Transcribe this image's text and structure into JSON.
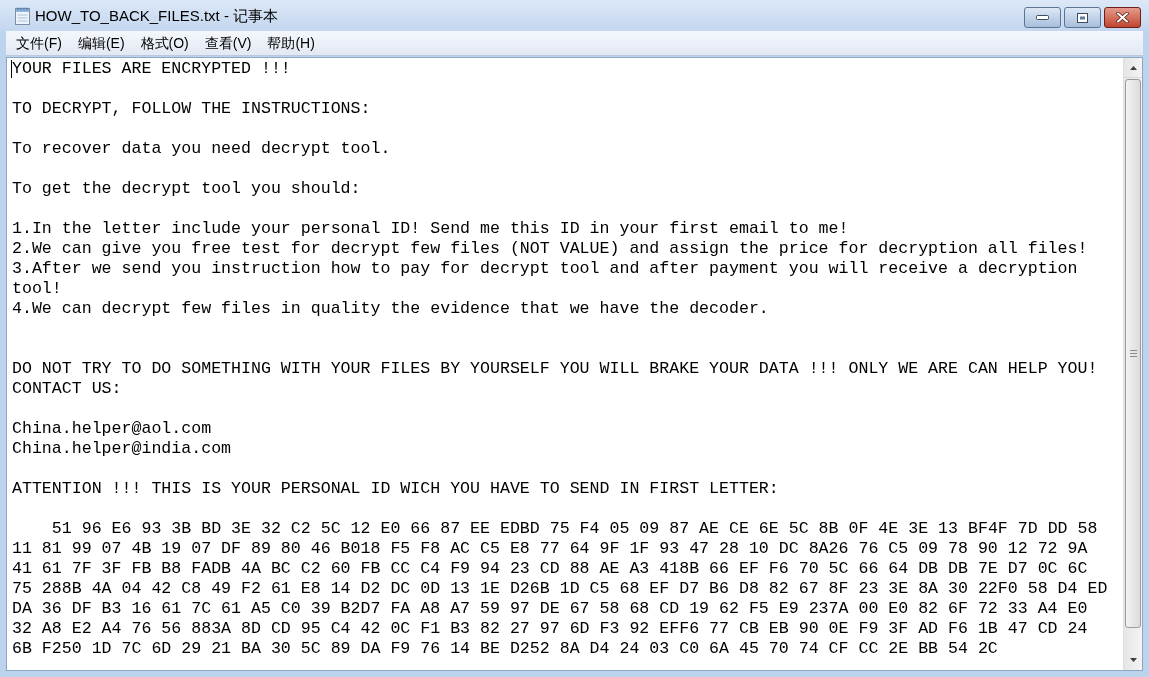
{
  "window": {
    "title": "HOW_TO_BACK_FILES.txt - 记事本"
  },
  "menu_bar": [
    "文件(F)",
    "编辑(E)",
    "格式(O)",
    "查看(V)",
    "帮助(H)"
  ],
  "document": {
    "lines": [
      {
        "kind": "text",
        "text": "YOUR FILES ARE ENCRYPTED !!!"
      },
      {
        "kind": "blank"
      },
      {
        "kind": "text",
        "text": "TO DECRYPT, FOLLOW THE INSTRUCTIONS:"
      },
      {
        "kind": "blank"
      },
      {
        "kind": "text",
        "text": "To recover data you need decrypt tool."
      },
      {
        "kind": "blank"
      },
      {
        "kind": "text",
        "text": "To get the decrypt tool you should:"
      },
      {
        "kind": "blank"
      },
      {
        "kind": "text",
        "text": "1.In the letter include your personal ID! Send me this ID in your first email to me!"
      },
      {
        "kind": "text",
        "text": "2.We can give you free test for decrypt few files (NOT VALUE) and assign the price for decryption all files!"
      },
      {
        "kind": "text",
        "text": "3.After we send you instruction how to pay for decrypt tool and after payment you will receive a decryption tool!"
      },
      {
        "kind": "text",
        "text": "4.We can decrypt few files in quality the evidence that we have the decoder."
      },
      {
        "kind": "blank"
      },
      {
        "kind": "blank"
      },
      {
        "kind": "text",
        "text": "DO NOT TRY TO DO SOMETHING WITH YOUR FILES BY YOURSELF YOU WILL BRAKE YOUR DATA !!! ONLY WE ARE CAN HELP YOU!"
      },
      {
        "kind": "text",
        "text": "CONTACT US:"
      },
      {
        "kind": "blank"
      },
      {
        "kind": "text",
        "text": "China.helper@aol.com"
      },
      {
        "kind": "text",
        "text": "China.helper@india.com"
      },
      {
        "kind": "blank"
      },
      {
        "kind": "text",
        "text": "ATTENTION !!! THIS IS YOUR PERSONAL ID WICH YOU HAVE TO SEND IN FIRST LETTER:"
      },
      {
        "kind": "blank"
      },
      {
        "kind": "text",
        "text": "    51 96 E6 93 3B BD 3E 32 C2 5C 12 E0 66 87 EE EDBD 75 F4 05 09 87 AE CE 6E 5C 8B 0F 4E 3E 13 BF4F 7D DD 58"
      },
      {
        "kind": "text",
        "text": "11 81 99 07 4B 19 07 DF 89 80 46 B018 F5 F8 AC C5 E8 77 64 9F 1F 93 47 28 10 DC 8A26 76 C5 09 78 90 12 72 9A"
      },
      {
        "kind": "text",
        "text": "41 61 7F 3F FB B8 FADB 4A BC C2 60 FB CC C4 F9 94 23 CD 88 AE A3 418B 66 EF F6 70 5C 66 64 DB DB 7E D7 0C 6C"
      },
      {
        "kind": "text",
        "text": "75 288B 4A 04 42 C8 49 F2 61 E8 14 D2 DC 0D 13 1E D26B 1D C5 68 EF D7 B6 D8 82 67 8F 23 3E 8A 30 22F0 58 D4 ED"
      },
      {
        "kind": "text",
        "text": "DA 36 DF B3 16 61 7C 61 A5 C0 39 B2D7 FA A8 A7 59 97 DE 67 58 68 CD 19 62 F5 E9 237A 00 E0 82 6F 72 33 A4 E0"
      },
      {
        "kind": "text",
        "text": "32 A8 E2 A4 76 56 883A 8D CD 95 C4 42 0C F1 B3 82 27 97 6D F3 92 EFF6 77 CB EB 90 0E F9 3F AD F6 1B 47 CD 24"
      },
      {
        "kind": "text",
        "text": "6B F250 1D 7C 6D 29 21 BA 30 5C 89 DA F9 76 14 BE D252 8A D4 24 03 C0 6A 45 70 74 CF CC 2E BB 54 2C"
      }
    ]
  }
}
